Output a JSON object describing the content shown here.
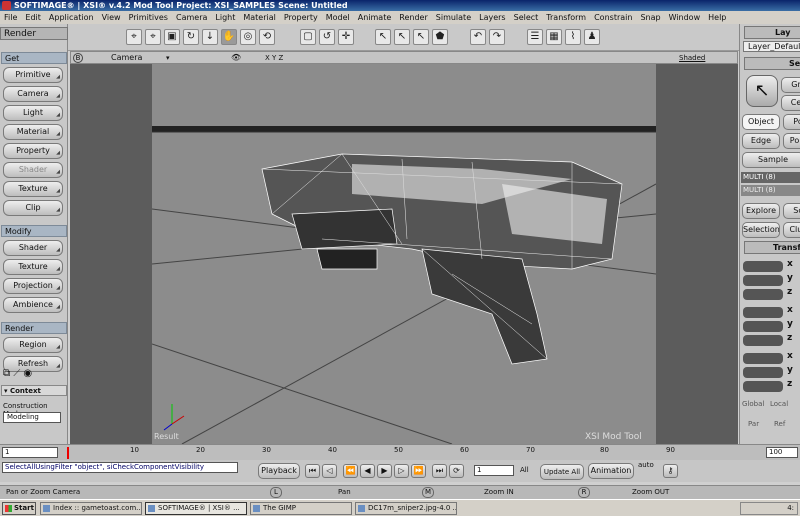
{
  "window": {
    "title": "SOFTIMAGE® | XSI® v.4.2 Mod Tool Project: XSI_SAMPLES    Scene: Untitled"
  },
  "menu": [
    "File",
    "Edit",
    "Application",
    "View",
    "Primitives",
    "Camera",
    "Light",
    "Material",
    "Property",
    "Model",
    "Animate",
    "Render",
    "Simulate",
    "Layers",
    "Select",
    "Transform",
    "Constrain",
    "Snap",
    "Window",
    "Help"
  ],
  "left": {
    "header": "Render",
    "get": {
      "title": "Get",
      "items": [
        "Primitive",
        "Camera",
        "Light",
        "Material",
        "Property",
        "Shader",
        "Texture",
        "Clip"
      ]
    },
    "modify": {
      "title": "Modify",
      "items": [
        "Shader",
        "Texture",
        "Projection",
        "Ambience"
      ]
    },
    "render": {
      "title": "Render",
      "items": [
        "Region",
        "Refresh"
      ]
    },
    "context": {
      "title": "▾ Context",
      "mode_label": "Construction Mode",
      "mode_value": "Modeling"
    }
  },
  "viewport": {
    "letter": "B",
    "camera": "Camera",
    "axes": "X Y Z",
    "shading": "Shaded",
    "result": "Result",
    "watermark": "XSI Mod Tool"
  },
  "right": {
    "layer_tab": "Lay",
    "layer": "Layer_Default",
    "sel_tab": "Se",
    "gr": "Gr",
    "ce": "Ce",
    "object": "Object",
    "po": "Po",
    "edge": "Edge",
    "poly": "Poly",
    "sample": "Sample",
    "multi1": "MULTI (8)",
    "multi2": "MULTI (8)",
    "explore": "Explore",
    "sc": "Sc",
    "selection": "Selection",
    "clus": "Clus",
    "transf": "Transf",
    "axes": [
      "x",
      "y",
      "z",
      "x",
      "y",
      "z",
      "x",
      "y",
      "z"
    ],
    "global": "Global",
    "local": "Local",
    "par": "Par",
    "ref": "Ref"
  },
  "timeline": {
    "start": "1",
    "ticks": [
      "10",
      "20",
      "30",
      "40",
      "50",
      "60",
      "70",
      "80",
      "90"
    ],
    "end": "100"
  },
  "commandline": "SelectAllUsingFilter \"object\", siCheckComponentVisibility",
  "playback": {
    "label": "Playback",
    "frame": "1",
    "all": "All",
    "update": "Update All",
    "animation": "Animation",
    "auto": "auto"
  },
  "status": {
    "left": "Pan or Zoom Camera",
    "l": "L",
    "pan": "Pan",
    "m": "M",
    "zoom_in": "Zoom IN",
    "r": "R",
    "zoom_out": "Zoom OUT"
  },
  "taskbar": {
    "start": "Start",
    "tasks": [
      "Index :: gametoast.com...",
      "SOFTIMAGE® | XSI® ...",
      "The GIMP",
      "DC17m_sniper2.jpg-4.0 ..."
    ],
    "clock": "4:"
  }
}
